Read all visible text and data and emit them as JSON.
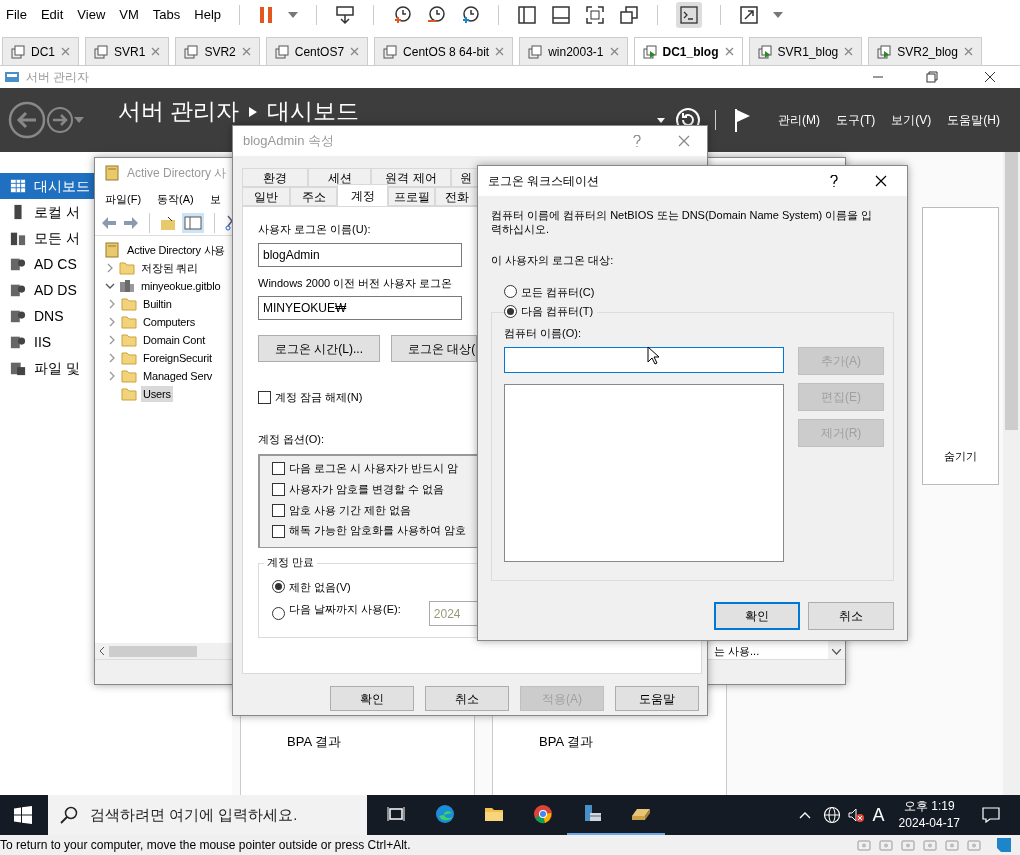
{
  "vm_menu": [
    "File",
    "Edit",
    "View",
    "VM",
    "Tabs",
    "Help"
  ],
  "vm_tabs": [
    {
      "label": "DC1",
      "selected": false,
      "powered_on": false
    },
    {
      "label": "SVR1",
      "selected": false,
      "powered_on": false
    },
    {
      "label": "SVR2",
      "selected": false,
      "powered_on": false
    },
    {
      "label": "CentOS7",
      "selected": false,
      "powered_on": false
    },
    {
      "label": "CentOS 8 64-bit",
      "selected": false,
      "powered_on": false
    },
    {
      "label": "win2003-1",
      "selected": false,
      "powered_on": false
    },
    {
      "label": "DC1_blog",
      "selected": true,
      "powered_on": true
    },
    {
      "label": "SVR1_blog",
      "selected": false,
      "powered_on": true
    },
    {
      "label": "SVR2_blog",
      "selected": false,
      "powered_on": true
    }
  ],
  "server_manager": {
    "window_title": "서버 관리자",
    "breadcrumb": [
      "서버 관리자",
      "대시보드"
    ],
    "menu": [
      "관리(M)",
      "도구(T)",
      "보기(V)",
      "도움말(H)"
    ],
    "sidebar": [
      {
        "label": "대시보드",
        "kind": "dashboard",
        "selected": true
      },
      {
        "label": "로컬 서",
        "kind": "server",
        "selected": false
      },
      {
        "label": "모든 서",
        "kind": "servers",
        "selected": false
      },
      {
        "label": "AD CS",
        "kind": "role",
        "selected": false
      },
      {
        "label": "AD DS",
        "kind": "role",
        "selected": false
      },
      {
        "label": "DNS",
        "kind": "role",
        "selected": false
      },
      {
        "label": "IIS",
        "kind": "role",
        "selected": false
      },
      {
        "label": "파일 및",
        "kind": "files",
        "selected": false
      }
    ],
    "hide_label": "숨기기",
    "tiles": [
      {
        "label": "BPA 결과"
      },
      {
        "label": "BPA 결과"
      }
    ]
  },
  "ad_window": {
    "title": "Active Directory 사",
    "menu": [
      "파일(F)",
      "동작(A)",
      "보"
    ],
    "tree": [
      {
        "label": "Active Directory 사용",
        "kind": "root",
        "selected": false,
        "children": [
          {
            "label": "저장된 쿼리",
            "kind": "folder",
            "selected": false,
            "expanded": false
          },
          {
            "label": "minyeokue.gitblo",
            "kind": "domain",
            "selected": false,
            "expanded": true,
            "children": [
              {
                "label": "Builtin",
                "kind": "folder",
                "selected": false,
                "expanded": false
              },
              {
                "label": "Computers",
                "kind": "folder",
                "selected": false,
                "expanded": false
              },
              {
                "label": "Domain Cont",
                "kind": "folder",
                "selected": false,
                "expanded": false
              },
              {
                "label": "ForeignSecurit",
                "kind": "folder",
                "selected": false,
                "expanded": false
              },
              {
                "label": "Managed Serv",
                "kind": "folder",
                "selected": false,
                "expanded": false
              },
              {
                "label": "Users",
                "kind": "folder",
                "selected": true
              }
            ]
          }
        ]
      }
    ],
    "list_cell": "는 사용..."
  },
  "properties_dialog": {
    "title": "blogAdmin 속성",
    "tab_rows": [
      [
        {
          "label": "환경",
          "selected": false
        },
        {
          "label": "세션",
          "selected": false
        },
        {
          "label": "원격 제어",
          "selected": false
        },
        {
          "label": "원",
          "selected": false
        }
      ],
      [
        {
          "label": "일반",
          "selected": false
        },
        {
          "label": "주소",
          "selected": false
        },
        {
          "label": "계정",
          "selected": true
        },
        {
          "label": "프로필",
          "selected": false
        },
        {
          "label": "전화",
          "selected": false
        }
      ]
    ],
    "logon_name_label": "사용자 로그온 이름(U):",
    "logon_name": "blogAdmin",
    "pre2000_label": "Windows 2000 이전 버전 사용자 로그온",
    "pre2000_domain": "MINYEOKUE₩",
    "logon_hours_button": "로그온 시간(L)...",
    "logon_to_button": "로그온 대상(",
    "unlock": {
      "label": "계정 잠금 해제(N)",
      "checked": false
    },
    "options_label": "계정 옵션(O):",
    "options": [
      {
        "label": "다음 로그온 시 사용자가 반드시 암",
        "checked": false
      },
      {
        "label": "사용자가 암호를 변경할 수 없음",
        "checked": false
      },
      {
        "label": "암호 사용 기간 제한 없음",
        "checked": false
      },
      {
        "label": "해독 가능한 암호화를 사용하여 암호",
        "checked": false
      }
    ],
    "expiry": {
      "legend": "계정 만료",
      "choices": [
        {
          "label": "제한 없음(V)",
          "selected": true
        },
        {
          "label": "다음 날짜까지 사용(E):",
          "selected": false
        }
      ],
      "date": "2024"
    },
    "buttons": [
      {
        "label": "확인",
        "disabled": false
      },
      {
        "label": "취소",
        "disabled": false
      },
      {
        "label": "적용(A)",
        "disabled": true
      },
      {
        "label": "도움말",
        "disabled": false
      }
    ]
  },
  "workstation_dialog": {
    "title": "로그온 워크스테이션",
    "instruction": "컴퓨터 이름에 컴퓨터의 NetBIOS 또는 DNS(Domain Name System) 이름을 입력하십시오.",
    "target_label": "이 사용자의 로그온 대상:",
    "choices": [
      {
        "label": "모든 컴퓨터(C)",
        "selected": false
      },
      {
        "label": "다음 컴퓨터(T)",
        "selected": true
      }
    ],
    "name_label": "컴퓨터 이름(O):",
    "side_buttons": [
      {
        "label": "추가(A)",
        "disabled": true
      },
      {
        "label": "편집(E)",
        "disabled": true
      },
      {
        "label": "제거(R)",
        "disabled": true
      }
    ],
    "buttons": [
      {
        "label": "확인",
        "default": true
      },
      {
        "label": "취소",
        "default": false
      }
    ]
  },
  "taskbar": {
    "search_placeholder": "검색하려면 여기에 입력하세요.",
    "apps": [
      {
        "kind": "taskview",
        "active": false
      },
      {
        "kind": "edge",
        "active": false
      },
      {
        "kind": "folder",
        "active": false
      },
      {
        "kind": "chrome",
        "active": false
      },
      {
        "kind": "server",
        "active": true
      },
      {
        "kind": "drive",
        "active": true
      }
    ],
    "ime": "A",
    "time": "오후 1:19",
    "date": "2024-04-17"
  },
  "status_bar": "To return to your computer, move the mouse pointer outside or press Ctrl+Alt."
}
